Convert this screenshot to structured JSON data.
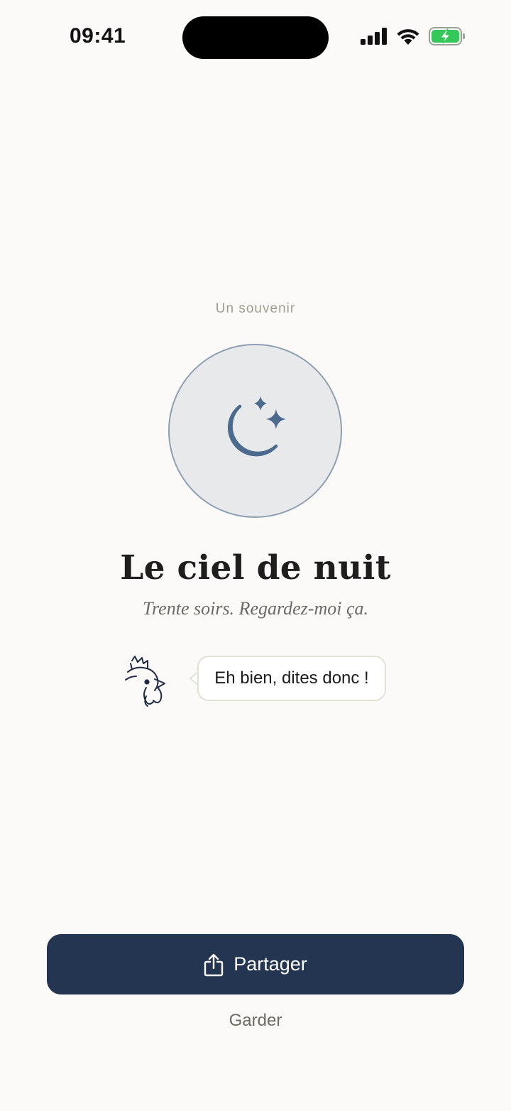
{
  "status_bar": {
    "time": "09:41",
    "icons": [
      "cellular-signal-icon",
      "wifi-icon",
      "battery-charging-icon"
    ],
    "battery_color": "#34c759"
  },
  "memory": {
    "eyebrow": "Un souvenir",
    "icon": "moon-stars-icon",
    "title": "Le ciel de nuit",
    "subtitle": "Trente soirs. Regardez-moi ça."
  },
  "mascot": {
    "icon": "rooster-icon",
    "speech": "Eh bien, dites donc !"
  },
  "actions": {
    "share_label": "Partager",
    "share_icon": "share-icon",
    "keep_label": "Garder"
  },
  "colors": {
    "background": "#fbfaf8",
    "accent": "#243552",
    "moon": "#4c6a8e"
  }
}
